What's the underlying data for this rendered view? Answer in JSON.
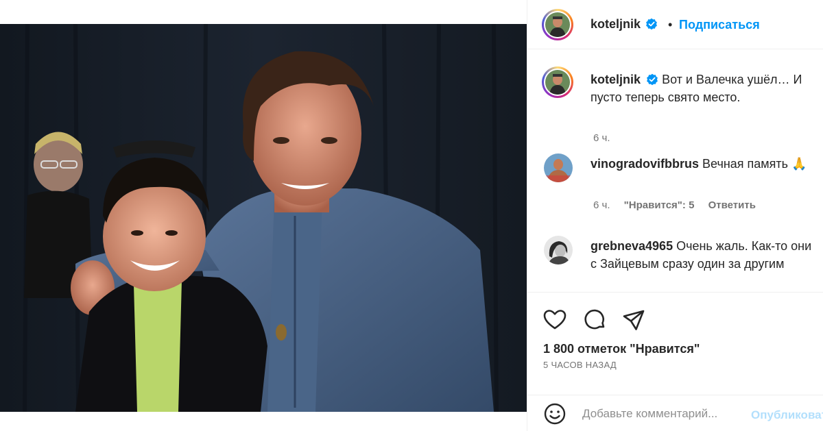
{
  "post": {
    "author": "koteljnik",
    "follow_label": "Подписаться",
    "separator": "•"
  },
  "caption": {
    "username": "koteljnik",
    "text": "Вот и Валечка ушёл… И пусто теперь свято место.",
    "time": "6 ч."
  },
  "comments": [
    {
      "username": "vinogradovifbbrus",
      "text": "Вечная память 🙏",
      "time": "6 ч.",
      "likes": "\"Нравится\": 5",
      "reply": "Ответить"
    },
    {
      "username": "grebneva4965",
      "text": "Очень жаль. Как-то они с Зайцевым сразу один за другим"
    }
  ],
  "actions": {
    "like_icon": "heart-icon",
    "comment_icon": "comment-icon",
    "share_icon": "share-icon",
    "likes_text": "1 800 отметок \"Нравится\"",
    "posted_ago": "5 ЧАСОВ НАЗАД"
  },
  "compose": {
    "placeholder": "Добавьте комментарий...",
    "publish_label": "Опубликовать",
    "emoji_icon": "smiley-icon"
  },
  "colors": {
    "link_blue": "#0095f6",
    "publish_disabled": "#b2dffc",
    "muted": "#737373",
    "verified": "#0095f6"
  }
}
